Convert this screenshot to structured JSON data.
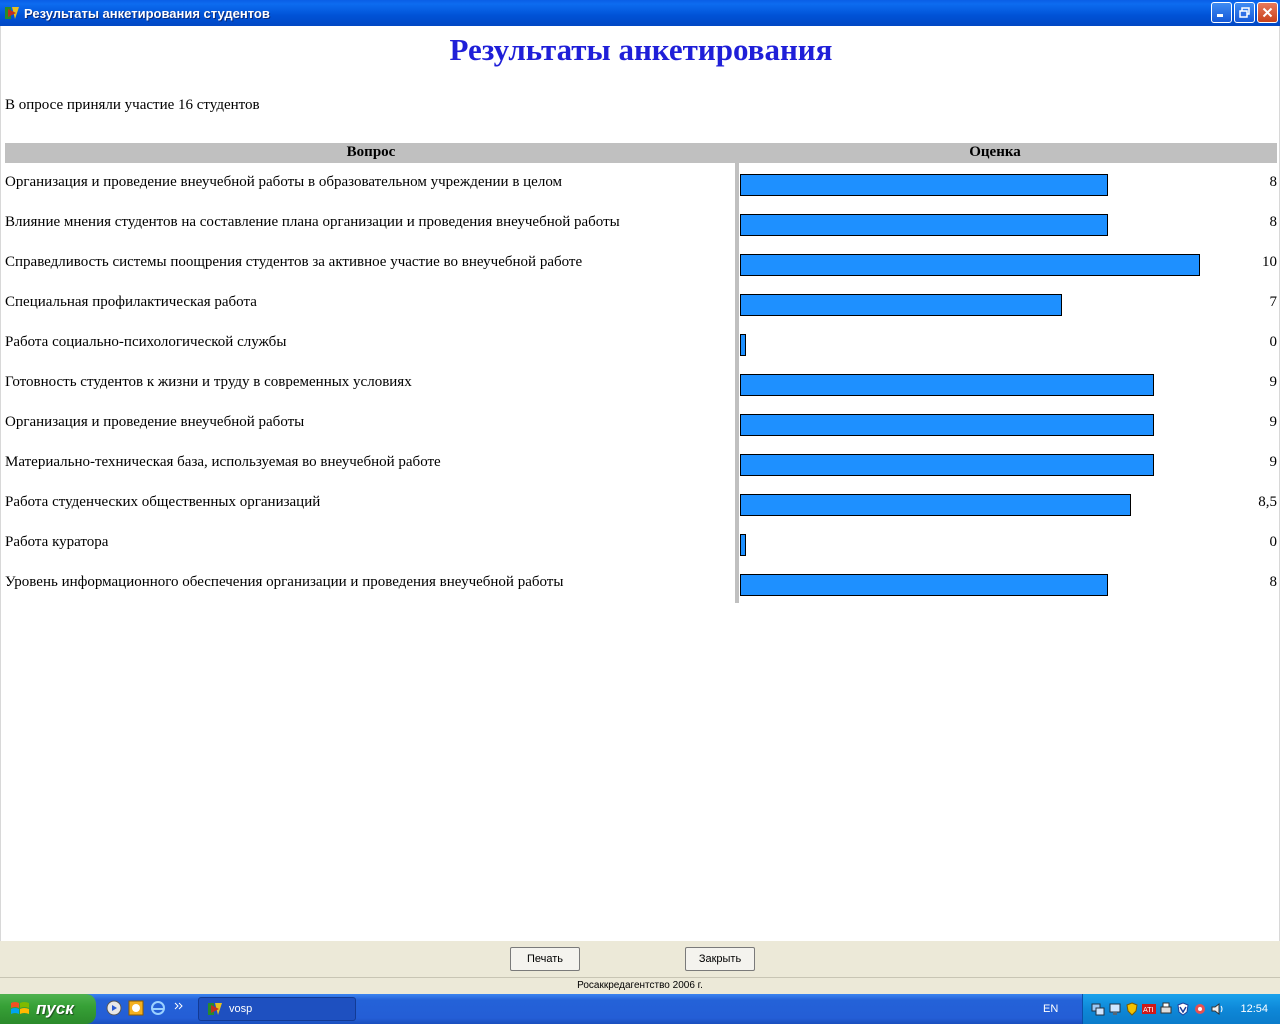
{
  "window": {
    "title": "Результаты анкетирования студентов",
    "icon": "app-icon"
  },
  "page": {
    "heading": "Результаты анкетирования",
    "participants_text": "В опросе приняли участие 16 студентов",
    "columns": {
      "question": "Вопрос",
      "score": "Оценка"
    }
  },
  "chart_data": {
    "type": "bar",
    "orientation": "horizontal",
    "max": 10,
    "bar_color": "#1e90ff",
    "categories": [
      "Организация и проведение внеучебной работы в образовательном учреждении в целом",
      "Влияние мнения студентов на составление плана организации и проведения внеучебной работы",
      "Справедливость системы поощрения студентов за активное участие во внеучебной работе",
      "Специальная профилактическая работа",
      "Работа социально-психологической службы",
      "Готовность студентов к жизни и труду в современных условиях",
      "Организация и проведение внеучебной работы",
      "Материально-техническая база, используемая во внеучебной работе",
      "Работа студенческих общественных организаций",
      "Работа куратора",
      "Уровень информационного обеспечения организации и проведения внеучебной работы"
    ],
    "values": [
      8,
      8,
      10,
      7,
      0,
      9,
      9,
      9,
      8.5,
      0,
      8
    ],
    "labels": [
      "8",
      "8",
      "10",
      "7",
      "0",
      "9",
      "9",
      "9",
      "8,5",
      "0",
      "8"
    ]
  },
  "buttons": {
    "print": "Печать",
    "close": "Закрыть"
  },
  "footer": {
    "copyright": "Росаккредагентство 2006 г."
  },
  "taskbar": {
    "start_label": "пуск",
    "task_label": "vosp",
    "language": "EN",
    "clock": "12:54"
  }
}
